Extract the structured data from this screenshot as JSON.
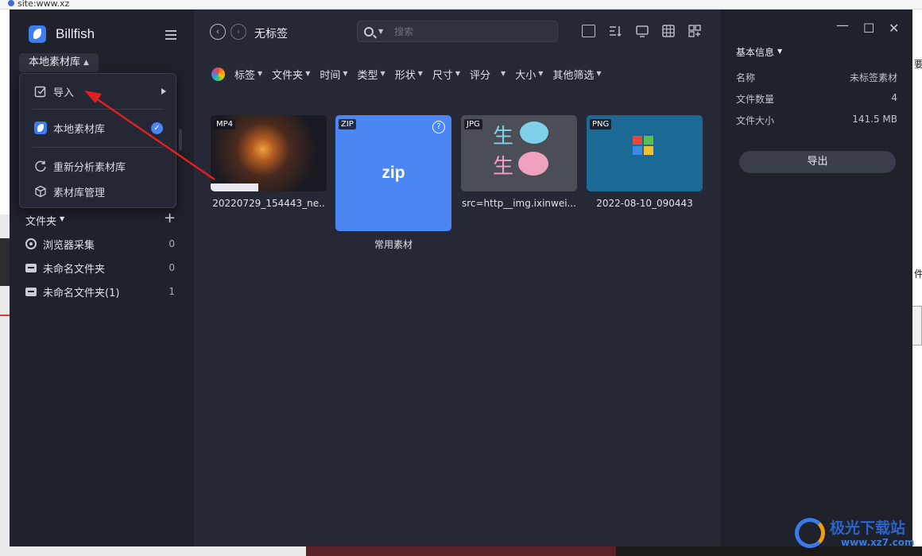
{
  "background": {
    "browser_url": "site:www.xz",
    "right_text_1": "要",
    "right_text_2": "件",
    "watermark_title": "极光下载站",
    "watermark_url": "www.xz7.com"
  },
  "app": {
    "name": "Billfish",
    "library_selector": "本地素材库",
    "dropdown": {
      "import": "导入",
      "local_library": "本地素材库",
      "reanalyze": "重新分析素材库",
      "manage": "素材库管理"
    },
    "folders": {
      "header": "文件夹",
      "items": [
        {
          "label": "浏览器采集",
          "count": "0"
        },
        {
          "label": "未命名文件夹",
          "count": "0"
        },
        {
          "label": "未命名文件夹(1)",
          "count": "1"
        }
      ]
    }
  },
  "main": {
    "title": "无标签",
    "search_placeholder": "搜索",
    "filters": [
      "标签",
      "文件夹",
      "时间",
      "类型",
      "形状",
      "尺寸",
      "评分",
      "大小",
      "其他筛选"
    ],
    "items": [
      {
        "badge": "MP4",
        "caption": "20220729_154443_ne.."
      },
      {
        "badge": "ZIP",
        "caption": "常用素材",
        "label": "zip"
      },
      {
        "badge": "JPG",
        "caption": "src=http__img.ixinwei..."
      },
      {
        "badge": "PNG",
        "caption": "2022-08-10_090443"
      }
    ],
    "jpg_chars": [
      "生",
      "生"
    ]
  },
  "info": {
    "header": "基本信息",
    "rows": [
      {
        "label": "名称",
        "value": "未标签素材"
      },
      {
        "label": "文件数量",
        "value": "4"
      },
      {
        "label": "文件大小",
        "value": "141.5 MB"
      }
    ],
    "export_label": "导出"
  },
  "colors": {
    "accent": "#4b86f5",
    "sidebar_bg": "#1f212b",
    "main_bg": "#262835",
    "annotation_arrow": "#e02020"
  }
}
